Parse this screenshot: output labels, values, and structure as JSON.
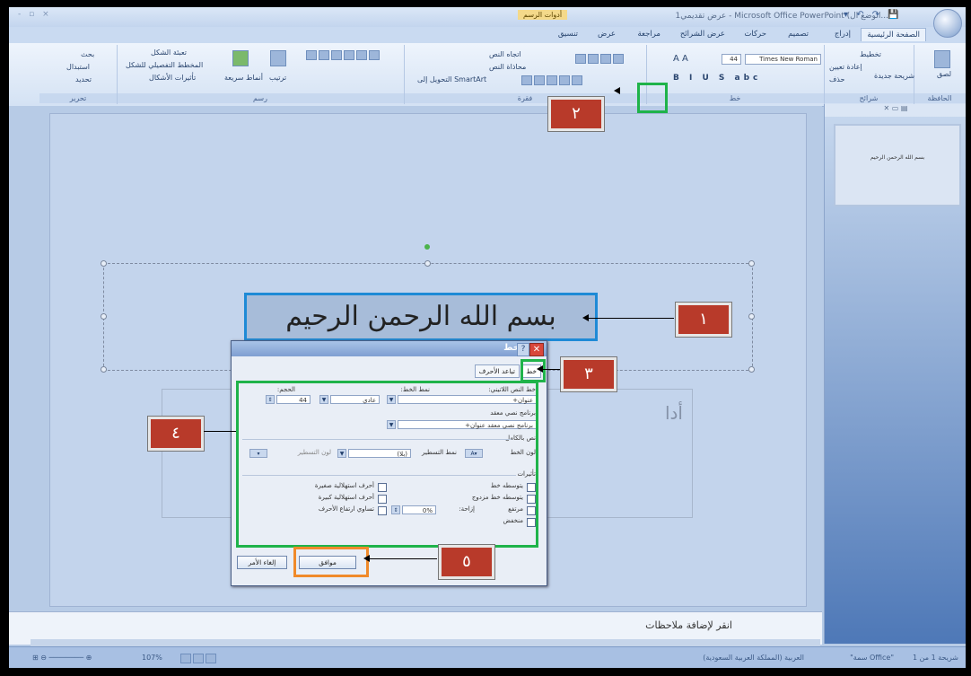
{
  "window": {
    "title": "عرض تقديمي1 - Microsoft Office PowerPoint (الوضع ال...",
    "contextual_tab": "أدوات الرسم",
    "window_controls": "- ▫ ×",
    "quick_access": "▾ ↶ ↷ 💾"
  },
  "ribbon": {
    "tabs": [
      "الصفحة الرئيسية",
      "إدراج",
      "تصميم",
      "حركات",
      "عرض الشرائح",
      "مراجعة",
      "عرض",
      "تنسيق"
    ],
    "font_name": "Times New Roman",
    "font_size": "44",
    "groups": {
      "clipboard": "الحافظة",
      "slides": "شرائح",
      "font": "خط",
      "paragraph": "فقرة",
      "drawing": "رسم",
      "editing": "تحرير"
    },
    "clipboard_paste": "لصق",
    "slides_items": [
      "تخطيط",
      "إعادة تعيين",
      "حذف",
      "شريحة جديدة"
    ],
    "paragraph_items": [
      "اتجاه النص",
      "محاذاة النص",
      "التحويل إلى SmartArt"
    ],
    "drawing_items": [
      "تعبئة الشكل",
      "المخطط التفصيلي للشكل",
      "تأثيرات الأشكال",
      "أنماط سريعة",
      "ترتيب"
    ],
    "editing_items": [
      "بحث",
      "استبدال",
      "تحديد"
    ]
  },
  "slide": {
    "title_text": "بسم الله الرحمن الرحيم",
    "subtitle_placeholder": "أدا"
  },
  "thumbnail": {
    "text": "بسم الله الرحمن الرحيم"
  },
  "notes": {
    "placeholder": "انقر لإضافة ملاحظات"
  },
  "status": {
    "slide_info": "شريحة 1 من 1",
    "theme": "\"سمة Office\"",
    "language": "العربية (المملكة العربية السعودية)",
    "zoom": "107%"
  },
  "dialog": {
    "title": "خط",
    "tabs": [
      "خط",
      "تباعد الأحرف"
    ],
    "latin_font_label": "خط النص اللاتيني:",
    "latin_font_value": "+عنوان",
    "style_label": "نمط الخط:",
    "style_value": "عادي",
    "size_label": "الحجم:",
    "size_value": "44",
    "complex_font_label": "برنامج نصي معقد",
    "complex_font_value": "+برنامج نصي معقد عنوان",
    "all_text_label": "نص بالكامل",
    "font_color_label": "لون الخط",
    "underline_style_label": "نمط التسطير",
    "underline_style_value": "(بلا)",
    "underline_color_label": "لون التسطير",
    "effects_label": "تأثيرات",
    "effects_right": [
      "يتوسطه خط",
      "يتوسطه خط مزدوج",
      "مرتفع",
      "منخفض"
    ],
    "offset_label": "إزاحة:",
    "offset_value": "0%",
    "effects_left": [
      "أحرف استهلالية صغيرة",
      "أحرف استهلالية كبيرة",
      "تساوي ارتفاع الأحرف"
    ],
    "ok": "موافق",
    "cancel": "إلغاء الأمر"
  },
  "callouts": [
    "١",
    "٢",
    "٣",
    "٤",
    "٥"
  ],
  "colors": {
    "highlight_green": "#1fb34a",
    "highlight_orange": "#f08a2a",
    "highlight_blue": "#1e8ad6",
    "callout_red": "#b83a2a"
  }
}
